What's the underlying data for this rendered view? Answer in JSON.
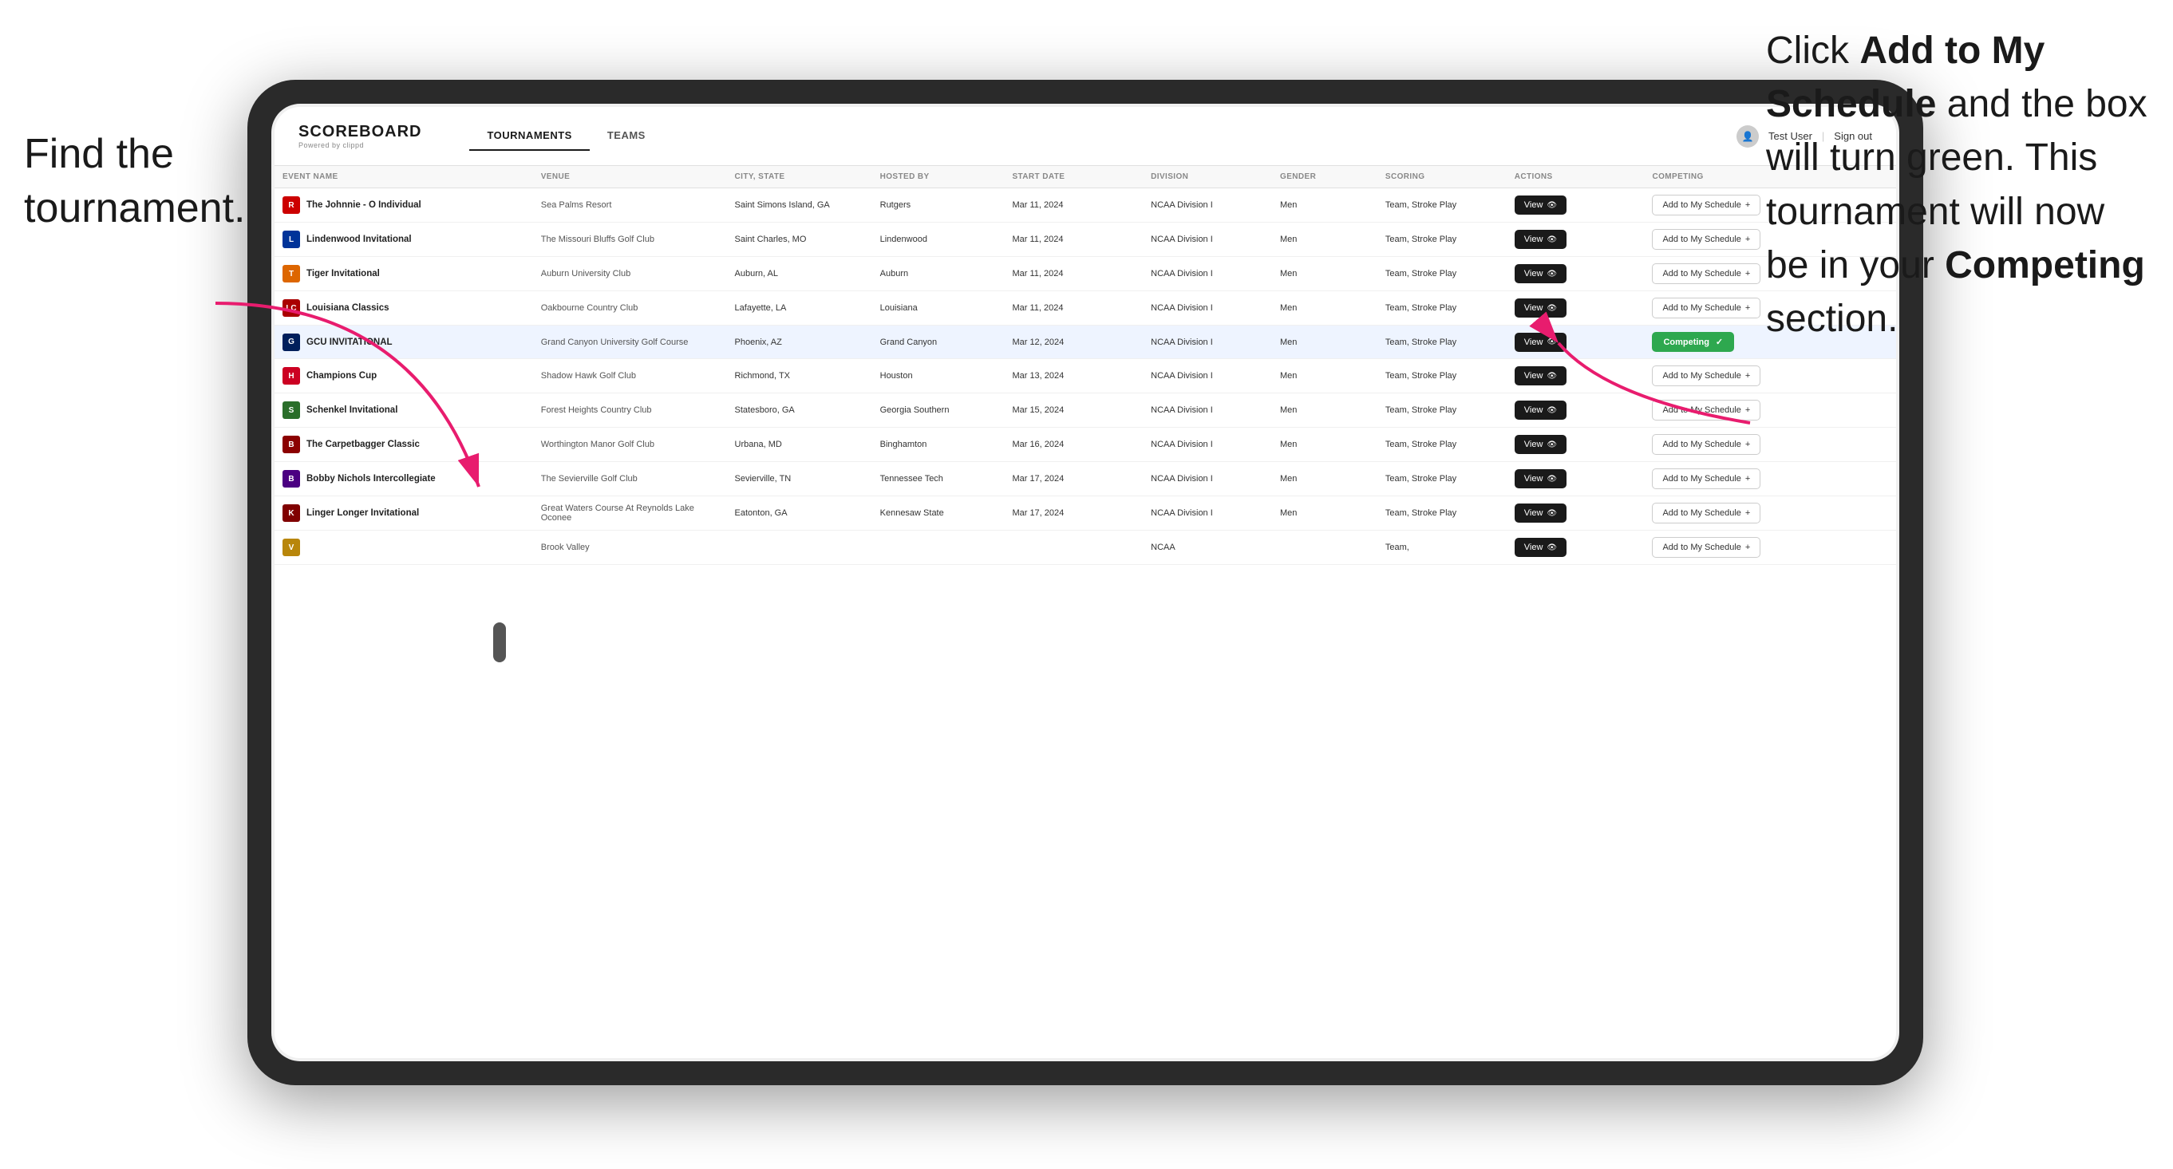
{
  "annotations": {
    "left": "Find the\ntournament.",
    "right_part1": "Click ",
    "right_bold1": "Add to My Schedule",
    "right_part2": " and the box will turn green. This tournament will now be in your ",
    "right_bold2": "Competing",
    "right_part3": " section."
  },
  "header": {
    "logo": "SCOREBOARD",
    "logo_sub": "Powered by clippd",
    "nav_tabs": [
      "TOURNAMENTS",
      "TEAMS"
    ],
    "active_tab": "TOURNAMENTS",
    "user": "Test User",
    "sign_out": "Sign out"
  },
  "table": {
    "columns": [
      "EVENT NAME",
      "VENUE",
      "CITY, STATE",
      "HOSTED BY",
      "START DATE",
      "DIVISION",
      "GENDER",
      "SCORING",
      "ACTIONS",
      "COMPETING"
    ],
    "rows": [
      {
        "logo_letter": "R",
        "logo_color": "red",
        "event": "The Johnnie - O Individual",
        "venue": "Sea Palms Resort",
        "city": "Saint Simons Island, GA",
        "hosted": "Rutgers",
        "date": "Mar 11, 2024",
        "division": "NCAA Division I",
        "gender": "Men",
        "scoring": "Team, Stroke Play",
        "action_btn": "View",
        "competing_btn": "Add to My Schedule",
        "is_competing": false,
        "highlighted": false
      },
      {
        "logo_letter": "L",
        "logo_color": "blue",
        "event": "Lindenwood Invitational",
        "venue": "The Missouri Bluffs Golf Club",
        "city": "Saint Charles, MO",
        "hosted": "Lindenwood",
        "date": "Mar 11, 2024",
        "division": "NCAA Division I",
        "gender": "Men",
        "scoring": "Team, Stroke Play",
        "action_btn": "View",
        "competing_btn": "Add to My Schedule",
        "is_competing": false,
        "highlighted": false
      },
      {
        "logo_letter": "T",
        "logo_color": "orange",
        "event": "Tiger Invitational",
        "venue": "Auburn University Club",
        "city": "Auburn, AL",
        "hosted": "Auburn",
        "date": "Mar 11, 2024",
        "division": "NCAA Division I",
        "gender": "Men",
        "scoring": "Team, Stroke Play",
        "action_btn": "View",
        "competing_btn": "Add to My Schedule",
        "is_competing": false,
        "highlighted": false
      },
      {
        "logo_letter": "LC",
        "logo_color": "red2",
        "event": "Louisiana Classics",
        "venue": "Oakbourne Country Club",
        "city": "Lafayette, LA",
        "hosted": "Louisiana",
        "date": "Mar 11, 2024",
        "division": "NCAA Division I",
        "gender": "Men",
        "scoring": "Team, Stroke Play",
        "action_btn": "View",
        "competing_btn": "Add to My Schedule",
        "is_competing": false,
        "highlighted": false
      },
      {
        "logo_letter": "G",
        "logo_color": "navy",
        "event": "GCU INVITATIONAL",
        "venue": "Grand Canyon University Golf Course",
        "city": "Phoenix, AZ",
        "hosted": "Grand Canyon",
        "date": "Mar 12, 2024",
        "division": "NCAA Division I",
        "gender": "Men",
        "scoring": "Team, Stroke Play",
        "action_btn": "View",
        "competing_btn": "Competing",
        "is_competing": true,
        "highlighted": true
      },
      {
        "logo_letter": "H",
        "logo_color": "red3",
        "event": "Champions Cup",
        "venue": "Shadow Hawk Golf Club",
        "city": "Richmond, TX",
        "hosted": "Houston",
        "date": "Mar 13, 2024",
        "division": "NCAA Division I",
        "gender": "Men",
        "scoring": "Team, Stroke Play",
        "action_btn": "View",
        "competing_btn": "Add to My Schedule",
        "is_competing": false,
        "highlighted": false
      },
      {
        "logo_letter": "S",
        "logo_color": "green",
        "event": "Schenkel Invitational",
        "venue": "Forest Heights Country Club",
        "city": "Statesboro, GA",
        "hosted": "Georgia Southern",
        "date": "Mar 15, 2024",
        "division": "NCAA Division I",
        "gender": "Men",
        "scoring": "Team, Stroke Play",
        "action_btn": "View",
        "competing_btn": "Add to My Schedule",
        "is_competing": false,
        "highlighted": false
      },
      {
        "logo_letter": "B",
        "logo_color": "crimson",
        "event": "The Carpetbagger Classic",
        "venue": "Worthington Manor Golf Club",
        "city": "Urbana, MD",
        "hosted": "Binghamton",
        "date": "Mar 16, 2024",
        "division": "NCAA Division I",
        "gender": "Men",
        "scoring": "Team, Stroke Play",
        "action_btn": "View",
        "competing_btn": "Add to My Schedule",
        "is_competing": false,
        "highlighted": false
      },
      {
        "logo_letter": "B",
        "logo_color": "purple",
        "event": "Bobby Nichols Intercollegiate",
        "venue": "The Sevierville Golf Club",
        "city": "Sevierville, TN",
        "hosted": "Tennessee Tech",
        "date": "Mar 17, 2024",
        "division": "NCAA Division I",
        "gender": "Men",
        "scoring": "Team, Stroke Play",
        "action_btn": "View",
        "competing_btn": "Add to My Schedule",
        "is_competing": false,
        "highlighted": false
      },
      {
        "logo_letter": "K",
        "logo_color": "maroon",
        "event": "Linger Longer Invitational",
        "venue": "Great Waters Course At Reynolds Lake Oconee",
        "city": "Eatonton, GA",
        "hosted": "Kennesaw State",
        "date": "Mar 17, 2024",
        "division": "NCAA Division I",
        "gender": "Men",
        "scoring": "Team, Stroke Play",
        "action_btn": "View",
        "competing_btn": "Add to My Schedule",
        "is_competing": false,
        "highlighted": false
      },
      {
        "logo_letter": "V",
        "logo_color": "gold",
        "event": "",
        "venue": "Brook Valley",
        "city": "",
        "hosted": "",
        "date": "",
        "division": "NCAA",
        "gender": "",
        "scoring": "Team,",
        "action_btn": "View",
        "competing_btn": "Add to My Schedule",
        "is_competing": false,
        "highlighted": false
      }
    ]
  },
  "colors": {
    "competing_green": "#2ea84f",
    "dark": "#1a1a1a",
    "highlight_row": "#eef4ff"
  }
}
